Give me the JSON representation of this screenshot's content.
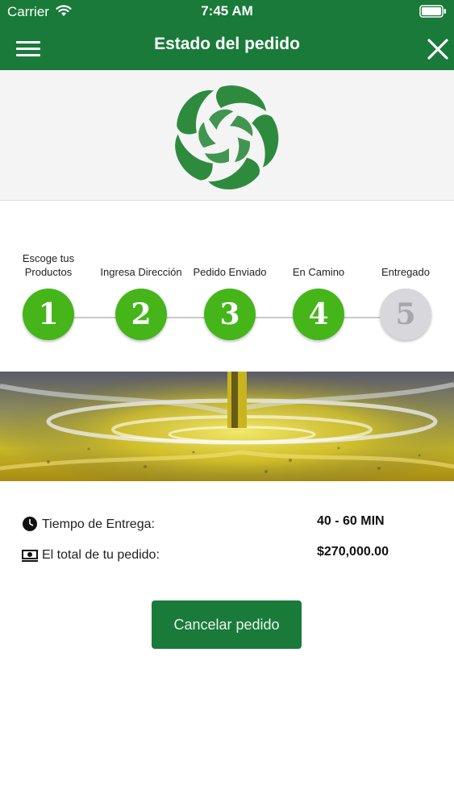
{
  "status_bar": {
    "carrier": "Carrier",
    "time": "7:45 AM"
  },
  "header": {
    "title": "Estado del pedido",
    "menu_icon": "hamburger-menu-icon",
    "close_icon": "close-icon",
    "background_color": "#1a7a3a"
  },
  "logo": {
    "icon": "leaf-ring-logo",
    "color": "#2e8b3e"
  },
  "steps": [
    {
      "number": "1",
      "label": "Escoge tus Productos",
      "status": "done"
    },
    {
      "number": "2",
      "label": "Ingresa Dirección",
      "status": "done"
    },
    {
      "number": "3",
      "label": "Pedido Enviado",
      "status": "done"
    },
    {
      "number": "4",
      "label": "En Camino",
      "status": "done"
    },
    {
      "number": "5",
      "label": "Entregado",
      "status": "pending"
    }
  ],
  "step_colors": {
    "done": "#45b51a",
    "pending": "#d8d8dc"
  },
  "banner": {
    "image": "olive-oil-pour-image"
  },
  "order_info": {
    "delivery_time_label": "Tiempo de Entrega:",
    "delivery_time_value": "40 - 60 MIN",
    "delivery_time_icon": "clock-icon",
    "total_label": "El total de tu pedido:",
    "total_value": "$270,000.00",
    "total_icon": "cash-icon"
  },
  "actions": {
    "cancel_label": "Cancelar pedido"
  }
}
